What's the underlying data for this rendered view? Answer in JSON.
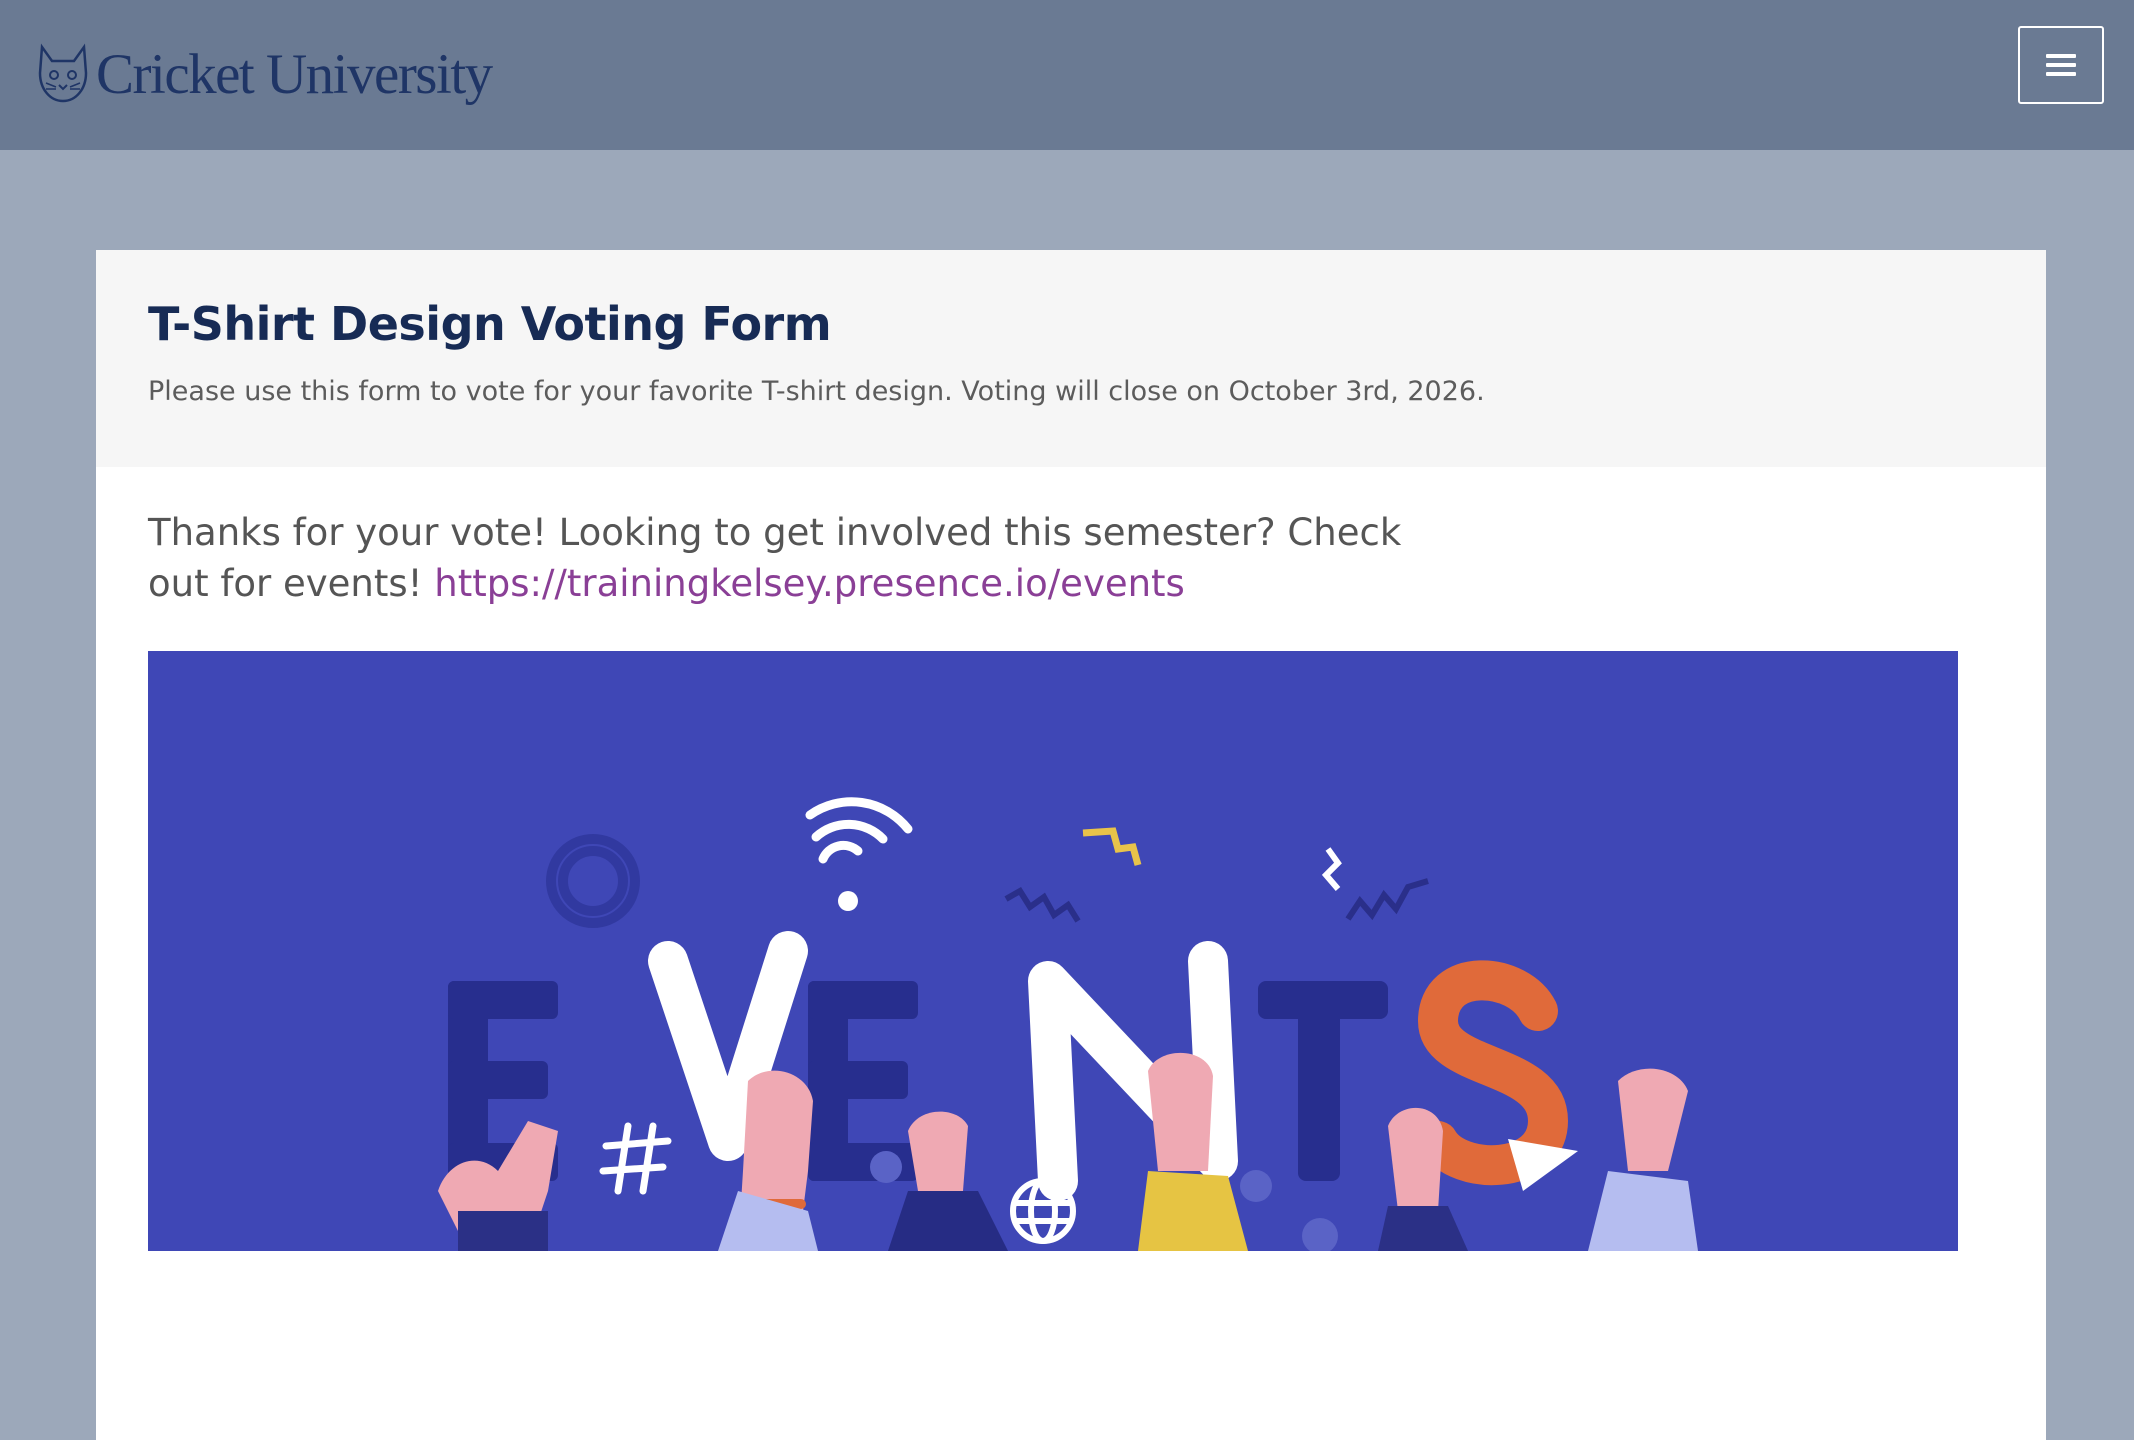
{
  "header": {
    "logo_text": "Cricket University",
    "menu_icon": "hamburger-menu-icon",
    "background": "#6a7a93"
  },
  "form": {
    "title": "T-Shirt Design Voting Form",
    "description": "Please use this form to vote for your favorite T-shirt design. Voting will close on October 3rd, 2026."
  },
  "confirmation": {
    "message": "Thanks for your vote! Looking to get involved this semester? Check out for events!",
    "link_text": "https://trainingkelsey.presence.io/events",
    "link_color": "#8a3f96"
  },
  "banner": {
    "letters": [
      "E",
      "V",
      "E",
      "N",
      "T",
      "S"
    ],
    "background": "#3f47b6",
    "accent": "#e06a3a"
  }
}
